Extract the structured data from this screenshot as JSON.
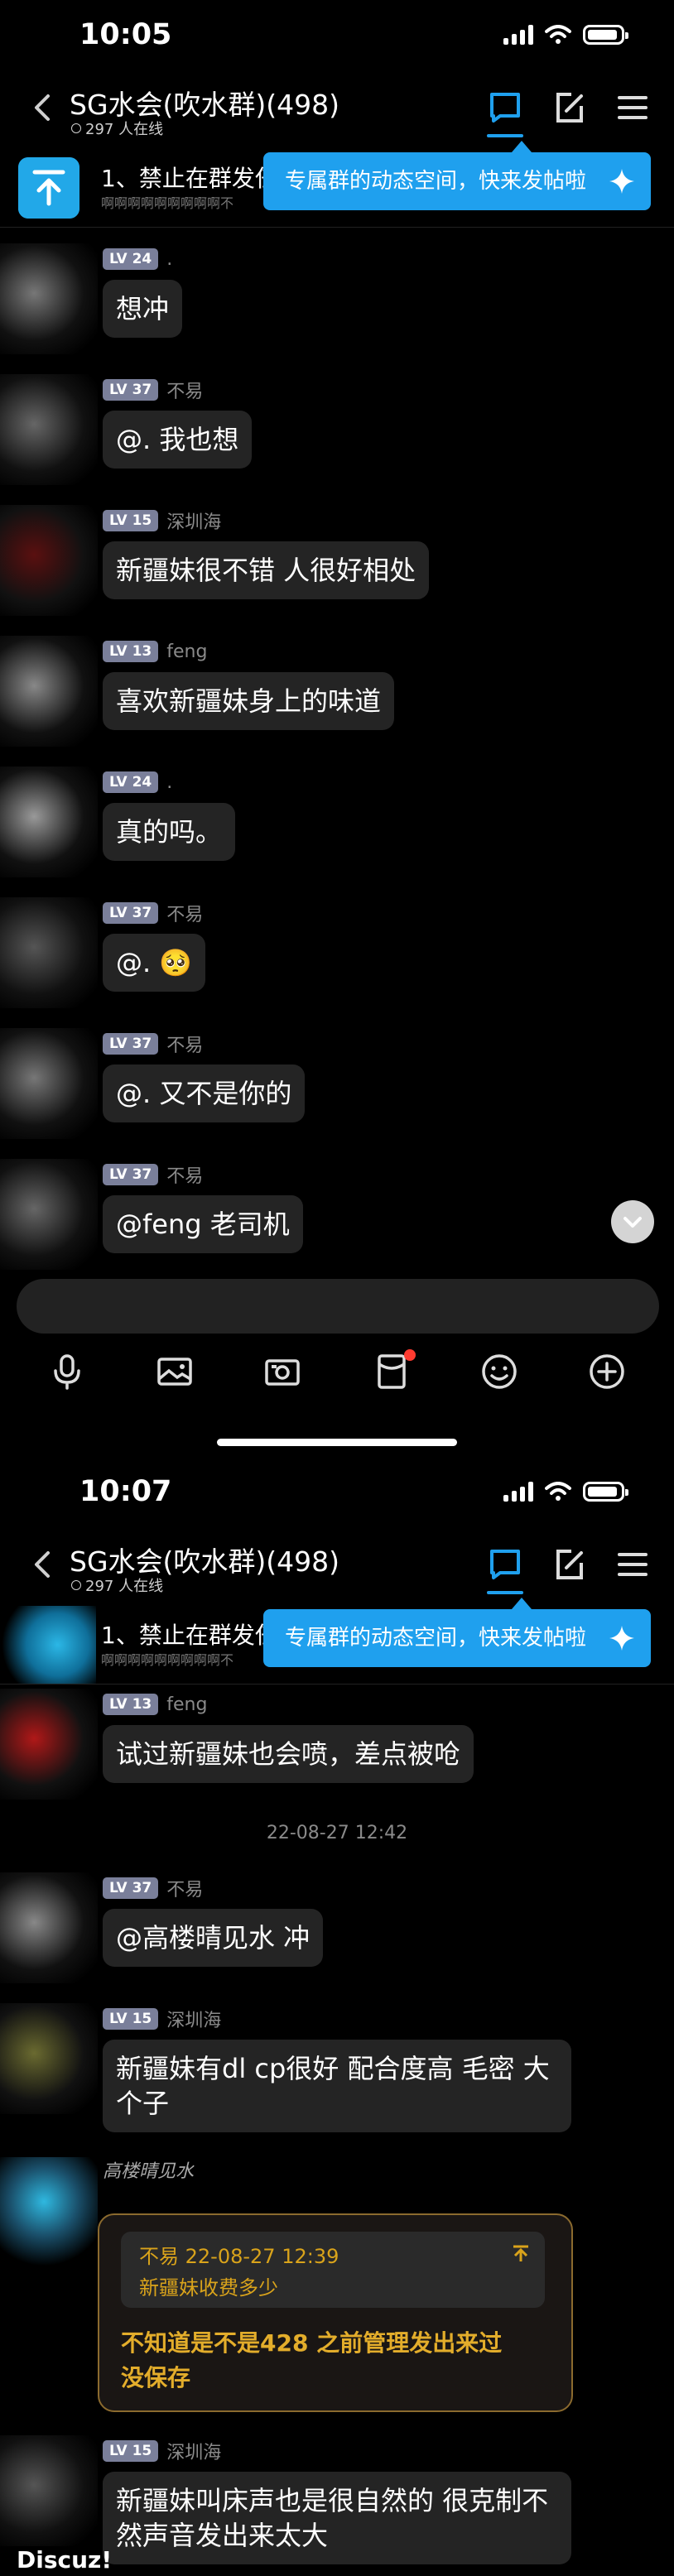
{
  "status_bar_1": {
    "time": "10:05"
  },
  "status_bar_2": {
    "time": "10:07"
  },
  "header": {
    "title": "SG水会(吹水群)(498)",
    "online": "297 人在线"
  },
  "pinned": {
    "text": "1、禁止在群发任",
    "sub": "啊啊啊啊啊啊啊啊啊不",
    "tooltip": "专属群的动态空间，快来发帖啦"
  },
  "screen1_messages": [
    {
      "level": "LV 24",
      "nick": ".",
      "text": "想冲"
    },
    {
      "level": "LV 37",
      "nick": "不易",
      "text": "@. 我也想"
    },
    {
      "level": "LV 15",
      "nick": "深圳海",
      "text": "新疆妹很不错 人很好相处"
    },
    {
      "level": "LV 13",
      "nick": "feng",
      "text": "喜欢新疆妹身上的味道"
    },
    {
      "level": "LV 24",
      "nick": ".",
      "text": "真的吗。"
    },
    {
      "level": "LV 37",
      "nick": "不易",
      "text": "@. 🥺"
    },
    {
      "level": "LV 37",
      "nick": "不易",
      "text": "@. 又不是你的"
    },
    {
      "level": "LV 37",
      "nick": "不易",
      "text": "@feng 老司机"
    }
  ],
  "screen2_messages": [
    {
      "level": "LV 13",
      "nick": "feng",
      "text": "试过新疆妹也会喷，差点被呛"
    },
    {
      "level": "LV 37",
      "nick": "不易",
      "text": "@高楼晴见水 冲"
    },
    {
      "level": "LV 15",
      "nick": "深圳海",
      "text": "新疆妹有dl cp很好 配合度高 毛密 大\n个子"
    },
    {
      "level": "LV 15",
      "nick": "深圳海",
      "text": "新疆妹叫床声也是很自然的 很克制不\n然声音发出来太大"
    }
  ],
  "timestamp": "22-08-27 12:42",
  "quote_msg": {
    "nick": "高楼晴见水",
    "quoted_header": "不易 22-08-27 12:39",
    "quoted_text": "新疆妹收费多少",
    "reply": "不知道是不是428 之前管理发出来过\n没保存"
  },
  "watermark": "Discuz!",
  "colors": {
    "accent": "#1fa0ee",
    "bubble": "#242424",
    "level_badge": "#7a7f9a",
    "gold": "#e3ad2b"
  }
}
